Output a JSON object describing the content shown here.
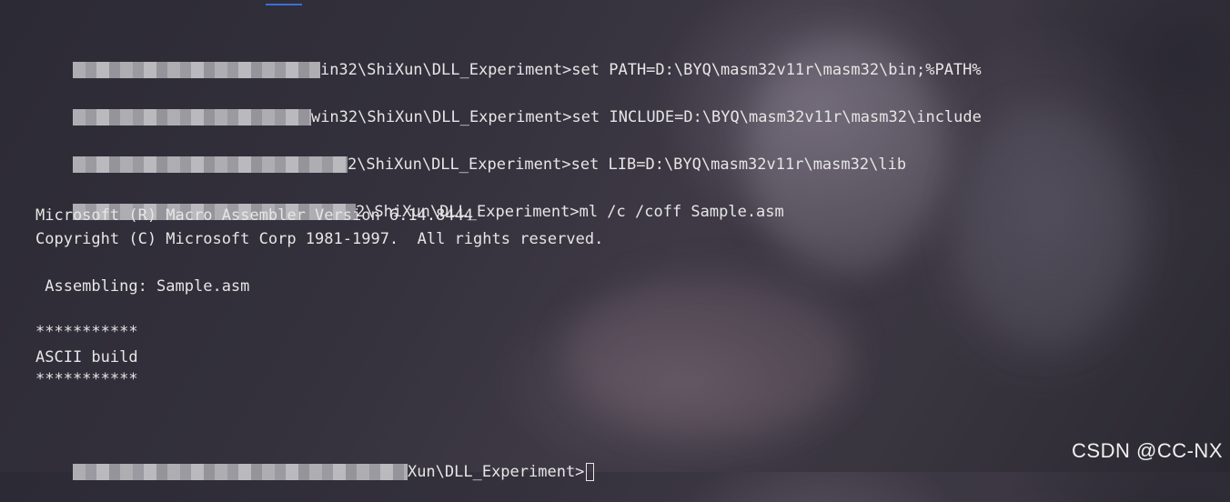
{
  "terminal": {
    "lines": [
      {
        "prompt_tail": "in32\\ShiXun\\DLL_Experiment>",
        "command": "set PATH=D:\\BYQ\\masm32v11r\\masm32\\bin;%PATH%"
      },
      {
        "prompt_tail": "win32\\ShiXun\\DLL_Experiment>",
        "command": "set INCLUDE=D:\\BYQ\\masm32v11r\\masm32\\include"
      },
      {
        "prompt_tail": "2\\ShiXun\\DLL_Experiment>",
        "command": "set LIB=D:\\BYQ\\masm32v11r\\masm32\\lib"
      },
      {
        "prompt_tail": "2\\ShiXun\\DLL_Experiment>",
        "command": "ml /c /coff Sample.asm"
      }
    ],
    "output": {
      "version_line": "Microsoft (R) Macro Assembler Version 6.14.8444",
      "copyright_line": "Copyright (C) Microsoft Corp 1981-1997.  All rights reserved.",
      "assembling_line": " Assembling: Sample.asm",
      "stars_top": "***********",
      "build_line": "ASCII build",
      "stars_bottom": "***********"
    },
    "final_prompt_tail": "Xun\\DLL_Experiment>"
  },
  "watermark": "CSDN @CC-NX",
  "colors": {
    "text": "#e6e6e6",
    "accent": "#3a6fd6"
  }
}
